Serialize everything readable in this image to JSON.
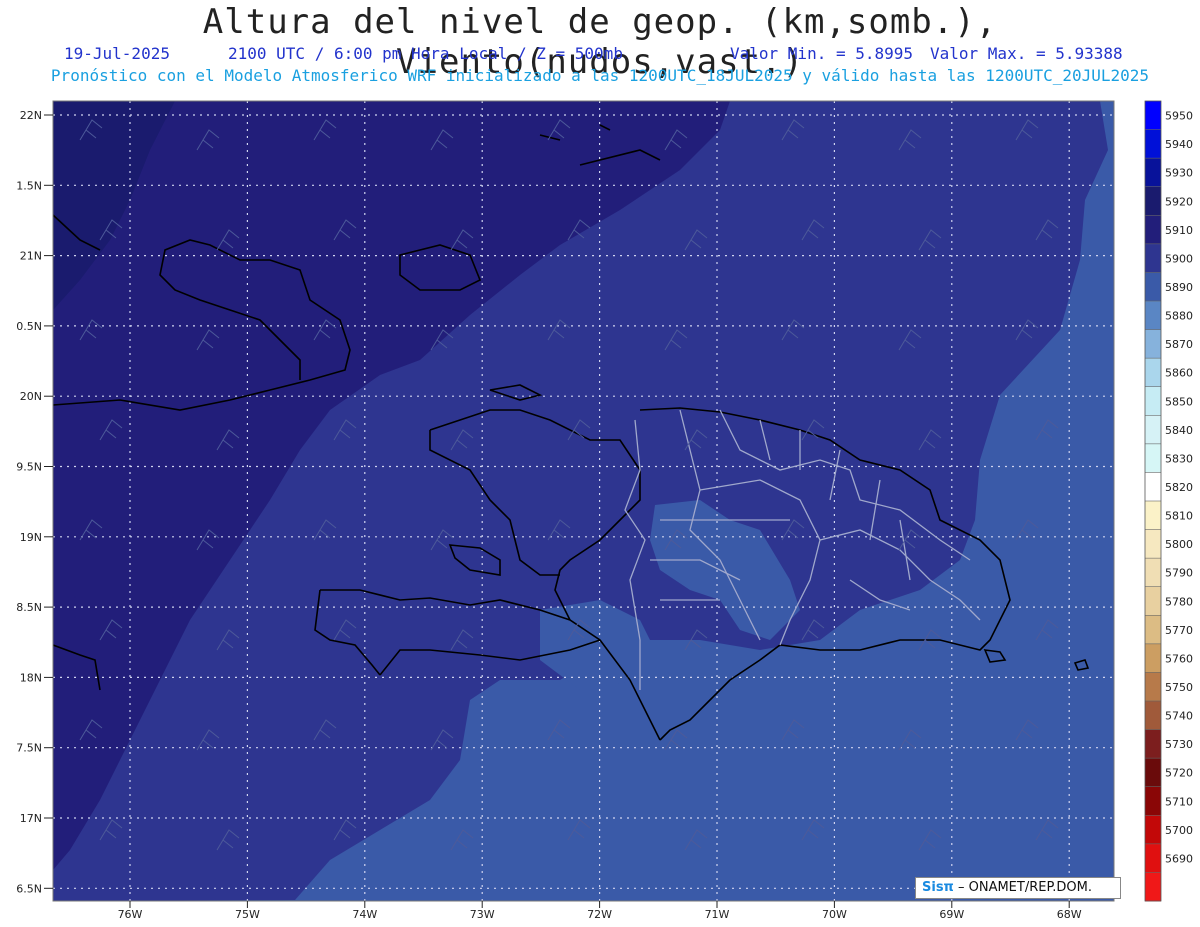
{
  "header": {
    "title": "Altura del nivel de geop. (km,somb.), Viento(nudos,vast.)",
    "date": "19-Jul-2025",
    "time": "2100 UTC / 6:00 pm Hora Local / Z = 500mb",
    "min_label": "Valor Min. = 5.8995",
    "max_label": "Valor Max. = 5.93388",
    "forecast_info": "Pronóstico con el Modelo Atmosferico WRF inicializado a las 1200UTC_18JUL2025 y válido hasta las  1200UTC_20JUL2025"
  },
  "map": {
    "lat_labels": [
      "22N",
      "1.5N",
      "21N",
      "0.5N",
      "20N",
      "9.5N",
      "19N",
      "8.5N",
      "18N",
      "7.5N",
      "17N",
      "6.5N"
    ],
    "lon_labels": [
      "76W",
      "75W",
      "74W",
      "73W",
      "72W",
      "71W",
      "70W",
      "69W",
      "68W"
    ],
    "fill_colors": {
      "z5930": "#1a1b6e",
      "z5920": "#221e7a",
      "z5910": "#2e3590",
      "z5900": "#3a5aa8",
      "z5890": "#4a70b8"
    }
  },
  "colorbar": {
    "levels": [
      "5950",
      "5940",
      "5930",
      "5920",
      "5910",
      "5900",
      "5890",
      "5880",
      "5870",
      "5860",
      "5850",
      "5840",
      "5830",
      "5820",
      "5810",
      "5800",
      "5790",
      "5780",
      "5770",
      "5760",
      "5750",
      "5740",
      "5730",
      "5720",
      "5710",
      "5700",
      "5690"
    ],
    "colors": [
      "#0000ff",
      "#0010d8",
      "#08129a",
      "#1a1b6e",
      "#221e7a",
      "#2e3590",
      "#3a5aa8",
      "#5a86c4",
      "#86b2dc",
      "#aad6ec",
      "#c6ecf4",
      "#d6f2f6",
      "#d6f6f6",
      "#ffffff",
      "#fbf2c8",
      "#f6e8c0",
      "#f0deb4",
      "#e8d0a0",
      "#dcbc84",
      "#cc9e62",
      "#b77a4a",
      "#a05a3a",
      "#7c1e1e",
      "#6a0b0b",
      "#8a0606",
      "#c20808",
      "#e01010"
    ],
    "colors_end": "#f01818"
  },
  "credit": {
    "logo": "Sisπ",
    "text": "– ONAMET/REP.DOM."
  }
}
